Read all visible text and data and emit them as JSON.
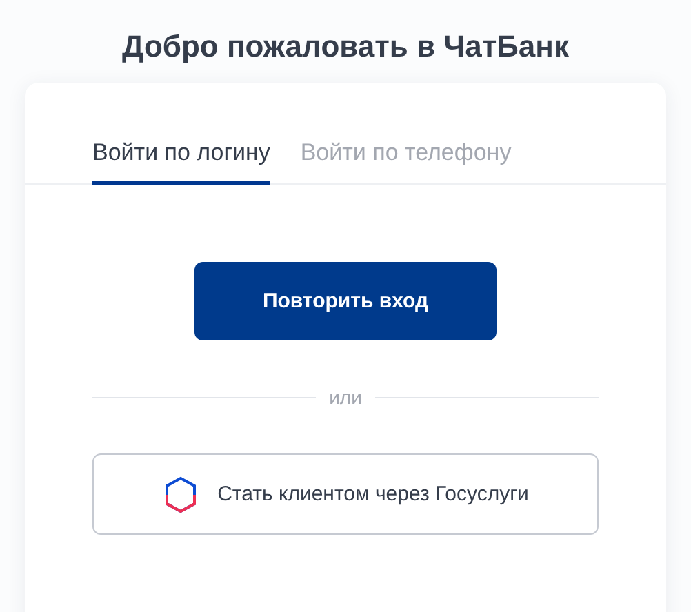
{
  "title": "Добро пожаловать в ЧатБанк",
  "tabs": [
    {
      "label": "Войти по логину",
      "selected": true
    },
    {
      "label": "Войти по телефону",
      "selected": false
    }
  ],
  "primary_button": "Повторить вход",
  "separator": "или",
  "gosuslugi_button": "Стать клиентом через Госуслуги"
}
